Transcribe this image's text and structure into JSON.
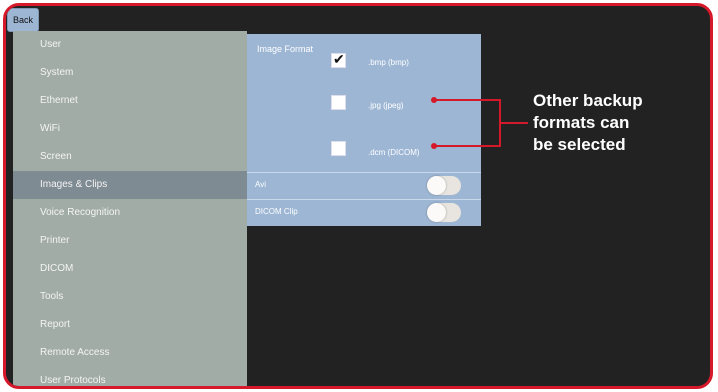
{
  "header": {
    "back_label": "Back"
  },
  "sidebar": {
    "items": [
      {
        "label": "User"
      },
      {
        "label": "System"
      },
      {
        "label": "Ethernet"
      },
      {
        "label": "WiFi"
      },
      {
        "label": "Screen"
      },
      {
        "label": "Images & Clips",
        "active": true
      },
      {
        "label": "Voice Recognition"
      },
      {
        "label": "Printer"
      },
      {
        "label": "DICOM"
      },
      {
        "label": "Tools"
      },
      {
        "label": "Report"
      },
      {
        "label": "Remote Access"
      },
      {
        "label": "User Protocols"
      }
    ]
  },
  "images_panel": {
    "image_format_label": "Image Format",
    "formats": [
      {
        "label": ".bmp (bmp)",
        "checked": true
      },
      {
        "label": ".jpg (jpeg)",
        "checked": false
      },
      {
        "label": ".dcm (DICOM)",
        "checked": false
      }
    ],
    "avi_label": "Avi",
    "avi_enabled": false,
    "dicom_clip_label": "DICOM Clip",
    "dicom_clip_enabled": false
  },
  "annotation": {
    "line1": "Other backup",
    "line2": "formats can",
    "line3": "be selected"
  },
  "colors": {
    "frame_border": "#d5192a",
    "sidebar_bg": "#a2aca6",
    "sidebar_active": "#7f8b93",
    "panel_bg": "#9db6d4",
    "background": "#222222",
    "annotation_line": "#d5192a"
  },
  "icons": [
    "checkmark-icon"
  ]
}
